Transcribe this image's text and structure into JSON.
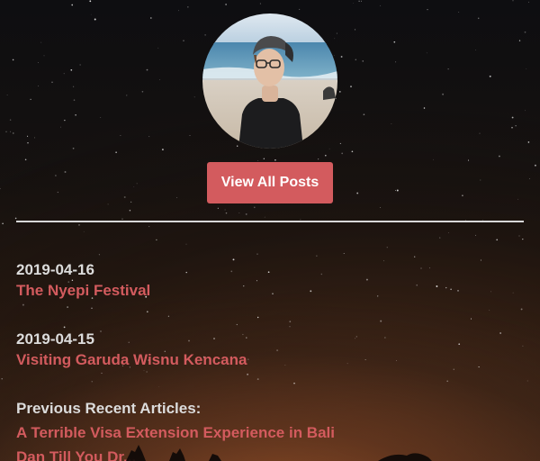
{
  "profile": {
    "avatar_icon": "profile-photo"
  },
  "actions": {
    "view_all_label": "View All Posts"
  },
  "recent_posts": [
    {
      "date": "2019-04-16",
      "title": "The Nyepi Festival"
    },
    {
      "date": "2019-04-15",
      "title": "Visiting Garuda Wisnu Kencana"
    }
  ],
  "previous": {
    "heading": "Previous Recent Articles:",
    "articles": [
      "A Terrible Visa Extension Experience in Bali",
      "Dan Till You Dr..."
    ]
  },
  "colors": {
    "accent": "#d35b5e",
    "text": "#dcdcdc",
    "divider": "#d8d8d8"
  }
}
